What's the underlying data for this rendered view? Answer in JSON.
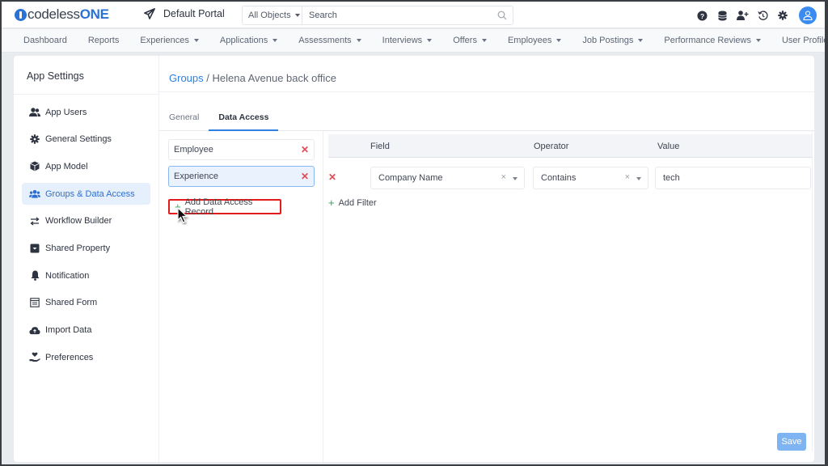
{
  "header": {
    "logo_text": "codeless",
    "logo_one": "ONE",
    "portal_label": "Default Portal",
    "object_filter": "All Objects",
    "search_placeholder": "Search",
    "icons": [
      "help-icon",
      "database-icon",
      "add-user-icon",
      "history-icon",
      "settings-icon",
      "user-avatar-icon"
    ]
  },
  "nav": {
    "items": [
      {
        "label": "Dashboard",
        "dropdown": false
      },
      {
        "label": "Reports",
        "dropdown": false
      },
      {
        "label": "Experiences",
        "dropdown": true
      },
      {
        "label": "Applications",
        "dropdown": true
      },
      {
        "label": "Assessments",
        "dropdown": true
      },
      {
        "label": "Interviews",
        "dropdown": true
      },
      {
        "label": "Offers",
        "dropdown": true
      },
      {
        "label": "Employees",
        "dropdown": true
      },
      {
        "label": "Job Postings",
        "dropdown": true
      },
      {
        "label": "Performance Reviews",
        "dropdown": true
      },
      {
        "label": "User Profile",
        "dropdown": true
      }
    ]
  },
  "sidebar": {
    "title": "App Settings",
    "items": [
      {
        "label": "App Users",
        "icon": "users-icon"
      },
      {
        "label": "General Settings",
        "icon": "gear-icon"
      },
      {
        "label": "App Model",
        "icon": "cube-icon"
      },
      {
        "label": "Groups & Data Access",
        "icon": "groups-icon",
        "active": true
      },
      {
        "label": "Workflow Builder",
        "icon": "exchange-icon"
      },
      {
        "label": "Shared Property",
        "icon": "box-icon"
      },
      {
        "label": "Notification",
        "icon": "bell-icon"
      },
      {
        "label": "Shared Form",
        "icon": "form-icon"
      },
      {
        "label": "Import Data",
        "icon": "cloud-upload-icon"
      },
      {
        "label": "Preferences",
        "icon": "hand-heart-icon"
      }
    ]
  },
  "main": {
    "breadcrumb": {
      "parent": "Groups",
      "separator": " / ",
      "current": "Helena Avenue back office"
    },
    "tabs": [
      {
        "label": "General",
        "active": false
      },
      {
        "label": "Data Access",
        "active": true
      }
    ],
    "records": [
      {
        "label": "Employee",
        "selected": false
      },
      {
        "label": "Experience",
        "selected": true
      }
    ],
    "add_record_label": "Add Data Access Record",
    "filter_table": {
      "headers": {
        "field": "Field",
        "operator": "Operator",
        "value": "Value"
      },
      "rows": [
        {
          "field": "Company Name",
          "operator": "Contains",
          "value": "tech"
        }
      ]
    },
    "add_filter_label": "Add Filter",
    "save_label": "Save"
  },
  "colors": {
    "accent": "#2f7fe0",
    "danger": "#e04b55",
    "success": "#2ba456",
    "highlight_border": "#e21b1b"
  }
}
